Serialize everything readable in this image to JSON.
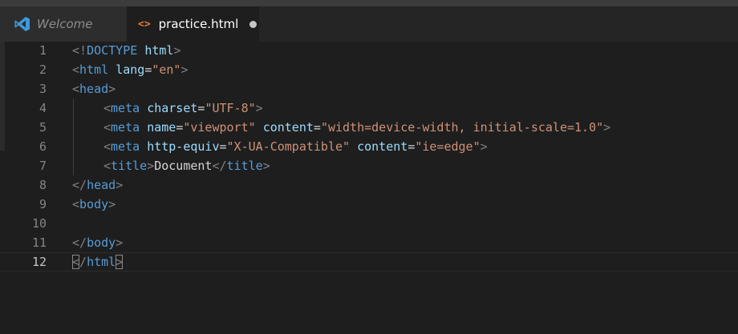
{
  "tabs": [
    {
      "label": "Welcome",
      "icon": "vscode-logo-icon",
      "active": false
    },
    {
      "label": "practice.html",
      "icon": "html-code-icon",
      "active": true,
      "modified": true
    }
  ],
  "editor": {
    "current_line": 12,
    "lines": [
      {
        "n": "1",
        "html": "<span class=\"br\">&lt;!</span><span class=\"tg\">DOCTYPE</span> <span class=\"at\">html</span><span class=\"br\">&gt;</span>"
      },
      {
        "n": "2",
        "html": "<span class=\"br\">&lt;</span><span class=\"tg\">html</span> <span class=\"at\">lang</span><span class=\"eq\">=</span><span class=\"st\">\"en\"</span><span class=\"br\">&gt;</span>"
      },
      {
        "n": "3",
        "html": "<span class=\"br\">&lt;</span><span class=\"tg\">head</span><span class=\"br\">&gt;</span>"
      },
      {
        "n": "4",
        "indent": true,
        "html": "<span class=\"br\">&lt;</span><span class=\"tg\">meta</span> <span class=\"at\">charset</span><span class=\"eq\">=</span><span class=\"st\">\"UTF-8\"</span><span class=\"br\">&gt;</span>"
      },
      {
        "n": "5",
        "indent": true,
        "html": "<span class=\"br\">&lt;</span><span class=\"tg\">meta</span> <span class=\"at\">name</span><span class=\"eq\">=</span><span class=\"st\">\"viewport\"</span> <span class=\"at\">content</span><span class=\"eq\">=</span><span class=\"st\">\"width=device-width, initial-scale=1.0\"</span><span class=\"br\">&gt;</span>"
      },
      {
        "n": "6",
        "indent": true,
        "html": "<span class=\"br\">&lt;</span><span class=\"tg\">meta</span> <span class=\"at\">http-equiv</span><span class=\"eq\">=</span><span class=\"st\">\"X-UA-Compatible\"</span> <span class=\"at\">content</span><span class=\"eq\">=</span><span class=\"st\">\"ie=edge\"</span><span class=\"br\">&gt;</span>"
      },
      {
        "n": "7",
        "indent": true,
        "html": "<span class=\"br\">&lt;</span><span class=\"tg\">title</span><span class=\"br\">&gt;</span><span class=\"tx\">Document</span><span class=\"br\">&lt;/</span><span class=\"tg\">title</span><span class=\"br\">&gt;</span>"
      },
      {
        "n": "8",
        "html": "<span class=\"br\">&lt;/</span><span class=\"tg\">head</span><span class=\"br\">&gt;</span>"
      },
      {
        "n": "9",
        "html": "<span class=\"br\">&lt;</span><span class=\"tg\">body</span><span class=\"br\">&gt;</span>"
      },
      {
        "n": "10",
        "html": ""
      },
      {
        "n": "11",
        "html": "<span class=\"br\">&lt;/</span><span class=\"tg\">body</span><span class=\"br\">&gt;</span>"
      },
      {
        "n": "12",
        "html": "<span class=\"br match\">&lt;</span><span class=\"br\">/</span><span class=\"tg\">html</span><span class=\"br match\">&gt;</span>"
      }
    ]
  },
  "colors": {
    "background": "#1e1e1e",
    "tab_bar": "#252526",
    "tag": "#569cd6",
    "attribute": "#9cdcfe",
    "string": "#ce9178",
    "bracket": "#808080"
  }
}
